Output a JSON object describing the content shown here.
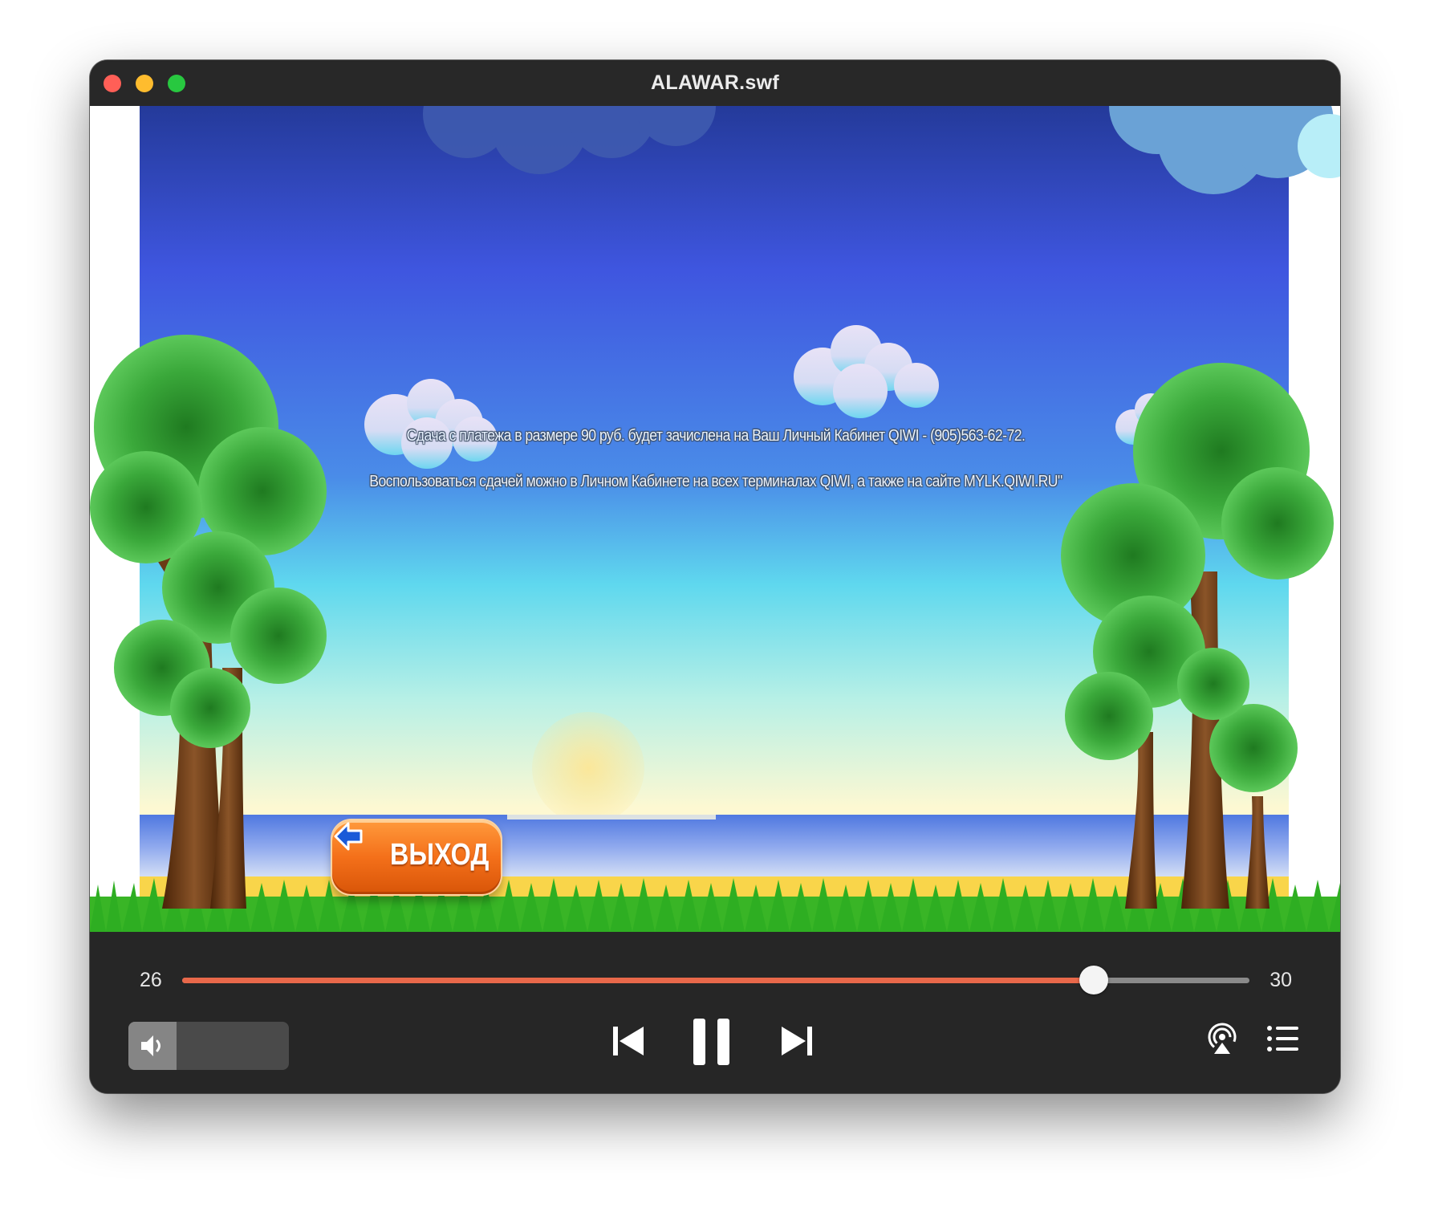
{
  "window": {
    "title": "ALAWAR.swf"
  },
  "content": {
    "message_line1": "Сдача с платежа в размере 90 руб. будет зачислена на Ваш Личный Кабинет QIWI - (905)563-62-72.",
    "message_line2": "Воспользоваться сдачей можно в Личном Кабинете на всех терминалах QIWI, а также на сайте MYLK.QIWI.RU\"",
    "exit_button": "ВЫХОД"
  },
  "player": {
    "current_time": "26",
    "total_time": "30",
    "progress": 0.854,
    "volume": 0.3,
    "accent_color": "#e8684a"
  },
  "icons": {
    "volume": "speaker-icon",
    "previous": "skip-back-icon",
    "play_pause": "pause-icon",
    "next": "skip-forward-icon",
    "airplay": "airplay-icon",
    "playlist": "list-icon"
  }
}
